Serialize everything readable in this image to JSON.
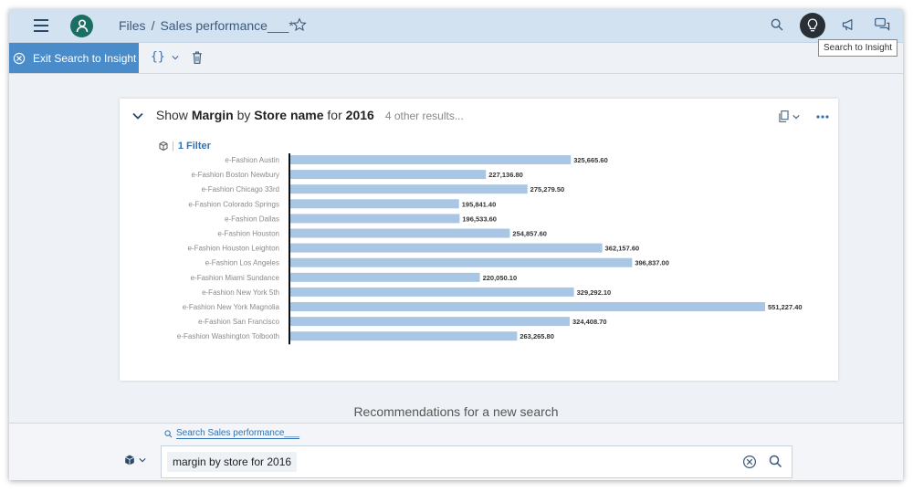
{
  "shell": {
    "breadcrumb_root": "Files",
    "breadcrumb_separator": "/",
    "document_title": "Sales performance___*"
  },
  "tooltip": {
    "text": "Search to Insight"
  },
  "toolbar": {
    "exit_label": "Exit Search to Insight",
    "braces_label": "{}"
  },
  "card": {
    "prefix": "Show ",
    "measure": "Margin",
    "by": " by ",
    "dimension": "Store name",
    "for": " for ",
    "year": "2016",
    "other_results": "4 other results...",
    "filter_label": "1 Filter"
  },
  "chart_data": {
    "type": "bar",
    "orientation": "horizontal",
    "categories": [
      "e-Fashion Austin",
      "e-Fashion Boston Newbury",
      "e-Fashion Chicago 33rd",
      "e-Fashion Colorado Springs",
      "e-Fashion Dallas",
      "e-Fashion Houston",
      "e-Fashion Houston Leighton",
      "e-Fashion Los Angeles",
      "e-Fashion Miami Sundance",
      "e-Fashion New York 5th",
      "e-Fashion New York Magnolia",
      "e-Fashion San Francisco",
      "e-Fashion Washington Tolbooth"
    ],
    "values": [
      325665.6,
      227136.8,
      275279.5,
      195841.4,
      196533.6,
      254857.6,
      362157.6,
      396837.0,
      220050.1,
      329292.1,
      551227.4,
      324408.7,
      263265.8
    ],
    "value_labels": [
      "325,665.60",
      "227,136.80",
      "275,279.50",
      "195,841.40",
      "196,533.60",
      "254,857.60",
      "362,157.60",
      "396,837.00",
      "220,050.10",
      "329,292.10",
      "551,227.40",
      "324,408.70",
      "263,265.80"
    ],
    "bar_color": "#a9c6e4",
    "grid": false
  },
  "recommendations": {
    "title": "Recommendations for a new search"
  },
  "search": {
    "model_link": "Search Sales performance___",
    "query": "margin by store for 2016"
  }
}
